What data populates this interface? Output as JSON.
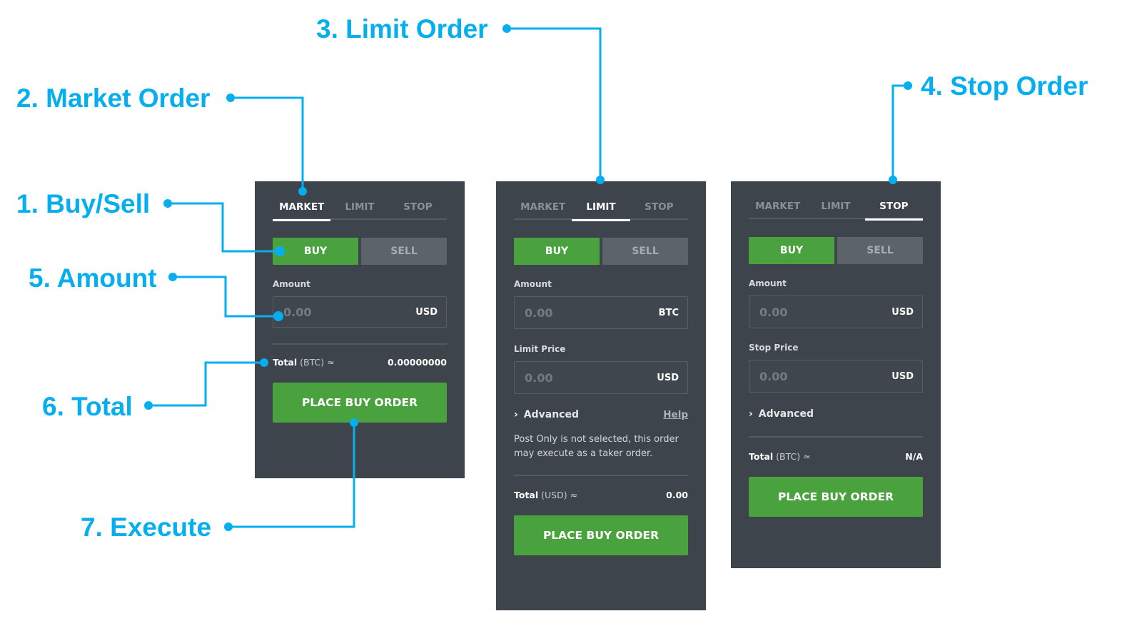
{
  "accent_color": "#05aeef",
  "buy_color": "#4aa23e",
  "panel_color": "#3d444c",
  "callouts": {
    "buy_sell": "1. Buy/Sell",
    "market_order": "2. Market Order",
    "limit_order": "3. Limit Order",
    "stop_order": "4. Stop Order",
    "amount": "5. Amount",
    "total": "6. Total",
    "execute": "7. Execute"
  },
  "panels": {
    "market": {
      "tabs": [
        "MARKET",
        "LIMIT",
        "STOP"
      ],
      "active_tab": "MARKET",
      "buy_label": "BUY",
      "sell_label": "SELL",
      "amount_label": "Amount",
      "amount_placeholder": "0.00",
      "amount_unit": "USD",
      "total_label": "Total",
      "total_currency": "(BTC) ≈",
      "total_value": "0.00000000",
      "place_label": "PLACE BUY ORDER"
    },
    "limit": {
      "tabs": [
        "MARKET",
        "LIMIT",
        "STOP"
      ],
      "active_tab": "LIMIT",
      "buy_label": "BUY",
      "sell_label": "SELL",
      "amount_label": "Amount",
      "amount_placeholder": "0.00",
      "amount_unit": "BTC",
      "price_label": "Limit Price",
      "price_placeholder": "0.00",
      "price_unit": "USD",
      "advanced_label": "Advanced",
      "help_label": "Help",
      "note": "Post Only is not selected, this order may execute as a taker order.",
      "total_label": "Total",
      "total_currency": "(USD) ≈",
      "total_value": "0.00",
      "place_label": "PLACE BUY ORDER"
    },
    "stop": {
      "tabs": [
        "MARKET",
        "LIMIT",
        "STOP"
      ],
      "active_tab": "STOP",
      "buy_label": "BUY",
      "sell_label": "SELL",
      "amount_label": "Amount",
      "amount_placeholder": "0.00",
      "amount_unit": "USD",
      "price_label": "Stop Price",
      "price_placeholder": "0.00",
      "price_unit": "USD",
      "advanced_label": "Advanced",
      "total_label": "Total",
      "total_currency": "(BTC) ≈",
      "total_value": "N/A",
      "place_label": "PLACE BUY ORDER"
    }
  },
  "icons": {
    "chevron": "›"
  }
}
